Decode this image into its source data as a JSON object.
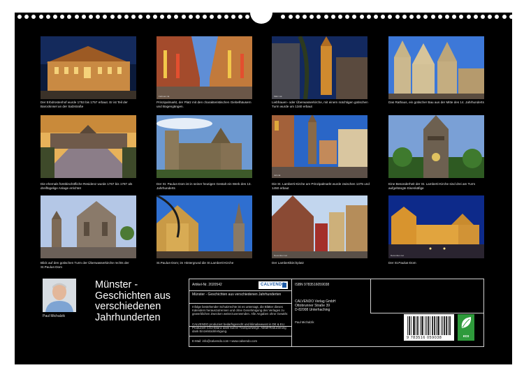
{
  "photos": [
    {
      "caption": "Der Erbdrostenhof wurde 1753 bis 1757 erbaut. Er ist Teil der Barockinsel an der Salzstraße",
      "credit": ""
    },
    {
      "caption": "Prinzipalmarkt, der Platz mit den charakteristischen Giebelhäusern und Bogengängen.",
      "credit": "Februar cal."
    },
    {
      "caption": "Liebfrauen- oder Überwasserkirche, mit einem mächtigen gotischen Turm wurde um 1340 erbaut",
      "credit": "März cal."
    },
    {
      "caption": "Das Rathaus, ein gotischer Bau aus der Mitte des 14. Jahrhunderts",
      "credit": ""
    },
    {
      "caption": "Die ehemals fürstbischöfliche Residenz wurde 1767 bis 1787 als dreiflügelige Anlage errichtet",
      "credit": ""
    },
    {
      "caption": "Der St. Paulus-Dom ist in seiner heutigen Gestalt ein Werk des 13. Jahrhunderts",
      "credit": ""
    },
    {
      "caption": "Die St. Lamberti-Kirche am Prinzipalmarkt wurde zwischen 1375 und 1450 erbaut",
      "credit": "Juli cal."
    },
    {
      "caption": "Eine Besonderheit der St. Lamberti-Kirche sind drei am Turm aufgehängte Eisenkäfige",
      "credit": ""
    },
    {
      "caption": "Blick auf den gotischen Turm der Überwasserkirche rechts der St.Paulus-Dom",
      "credit": ""
    },
    {
      "caption": "St.Paulus-Dom; im Hintergrund die St.Lamberti-Kirche",
      "credit": ""
    },
    {
      "caption": "Der Lambertikirchplatz",
      "credit": "November cal."
    },
    {
      "caption": "Der St.Paulus-Dom",
      "credit": "Dezember cal."
    }
  ],
  "author": {
    "name": "Paul Michalzik"
  },
  "title": "Münster - Geschichten aus verschiedenen Jahrhunderten",
  "info": {
    "article_number": "Artikel-Nr. 2020542",
    "logo": "CALVENDO",
    "subtitle": "Münster - Geschichten aus verschiedenen Jahrhunderten",
    "copyright": "Infolge bestehender Schutzrechte ist es untersagt, die Blätter dieses Kalenders herauszutrennen und ohne Genehmigung des Verlages zu gewerblichen Zwecken weiterzuverwenden. Alle Angaben ohne Gewähr.",
    "climate": "CALVENDO produziert bedarfsgerecht und klimabewusst in DE & EU. Produziert CO2-Bilanz dank kurzer Transportwege. Abfall-Reduzierung dank Einzelstückfertigung.",
    "contact": "E-Mail: info@calvendo.com • www.calvendo.com",
    "isbn": "ISBN 9783516059038",
    "publisher_lines": [
      "CALVENDO Verlag GmbH",
      "Ottobrunner Straße 39",
      "D-82008 Unterhaching"
    ],
    "photographer": "Paul Michalzik",
    "barcode_digits": "9 783516 059038",
    "eco_label": "eco"
  },
  "colors": {
    "background": "#000000",
    "page": "#ffffff",
    "eco": "#2e9a3b",
    "brand": "#1d5aa5"
  }
}
